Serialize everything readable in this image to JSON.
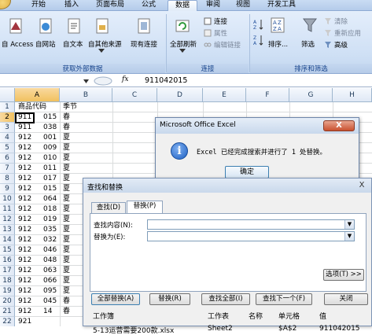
{
  "ribbon": {
    "tabs": [
      "开始",
      "插入",
      "页面布局",
      "公式",
      "数据",
      "审阅",
      "视图",
      "开发工具"
    ],
    "active_tab": "数据",
    "get_external": {
      "access": "自 Access",
      "web": "自网站",
      "text": "自文本",
      "other": "自其他来源",
      "existing": "现有连接",
      "group_label": "获取外部数据"
    },
    "connections": {
      "refresh_all": "全部刷新",
      "connections": "连接",
      "properties": "属性",
      "edit_links": "编辑链接",
      "group_label": "连接"
    },
    "sort_filter": {
      "sort": "排序...",
      "filter": "筛选",
      "clear": "清除",
      "reapply": "重新应用",
      "advanced": "高级",
      "group_label": "排序和筛选"
    }
  },
  "formula_bar": {
    "fx": "fx",
    "value": "911042015"
  },
  "sheet": {
    "columns": [
      "A",
      "B",
      "C",
      "D",
      "E",
      "F",
      "G",
      "H"
    ],
    "selected_column": "A",
    "row_numbers": [
      "1",
      "2",
      "3",
      "4",
      "5",
      "6",
      "7",
      "8",
      "9",
      "10",
      "11",
      "12",
      "13",
      "14",
      "15",
      "16",
      "17",
      "18",
      "19",
      "20",
      "21",
      "22"
    ],
    "selected_row": "2",
    "header_a": "商品代码",
    "header_b": "季节",
    "col_a_left": [
      "911",
      "911",
      "912",
      "912",
      "912",
      "912",
      "912",
      "912",
      "912",
      "912",
      "912",
      "912",
      "912",
      "912",
      "912",
      "912",
      "912",
      "912",
      "912",
      "912",
      "921"
    ],
    "col_a_right": [
      "015",
      "038",
      "001",
      "009",
      "010",
      "011",
      "017",
      "015",
      "064",
      "018",
      "019",
      "035",
      "032",
      "046",
      "048",
      "063",
      "066",
      "095",
      "045",
      "14"
    ],
    "col_b": [
      "春",
      "春",
      "夏",
      "夏",
      "夏",
      "夏",
      "夏",
      "夏",
      "夏",
      "夏",
      "夏",
      "夏",
      "夏",
      "夏",
      "夏",
      "夏",
      "夏",
      "夏",
      "春",
      "春"
    ]
  },
  "message_box": {
    "title": "Microsoft Office Excel",
    "close": "X",
    "icon": "i",
    "text": "Excel 已经完成搜索并进行了 1 处替换。",
    "ok": "确定"
  },
  "find_replace": {
    "title": "查找和替换",
    "close": "X",
    "tab_find": "查找(D)",
    "tab_replace": "替换(P)",
    "find_label": "查找内容(N):",
    "find_value": "",
    "replace_label": "替换为(E):",
    "replace_value": "",
    "options": "选项(T) >>",
    "replace_all": "全部替换(A)",
    "replace": "替换(R)",
    "find_all": "查找全部(I)",
    "find_next": "查找下一个(F)",
    "close_btn": "关闭",
    "results_headers": [
      "工作簿",
      "工作表",
      "名称",
      "单元格",
      "值"
    ],
    "result": {
      "workbook": "5-13运营需要200款.xlsx",
      "sheet": "Sheet2",
      "name": "",
      "cell": "$A$2",
      "value": "911042015"
    }
  }
}
